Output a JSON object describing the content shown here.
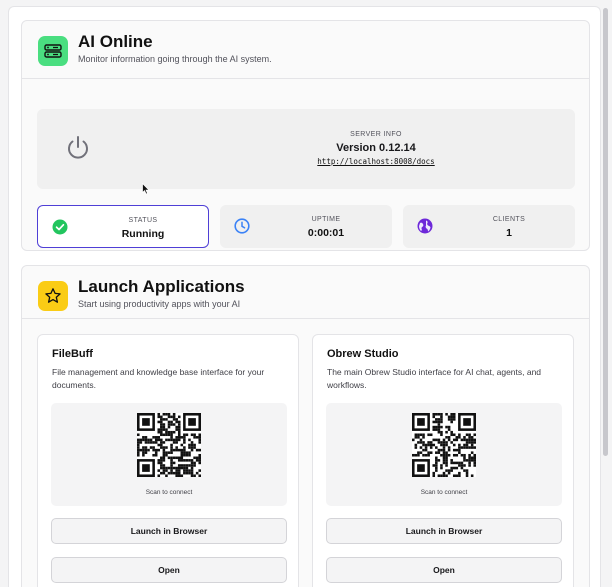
{
  "status_card": {
    "title": "AI Online",
    "subtitle": "Monitor information going through the AI system.",
    "icon": "server-icon",
    "icon_bg": "#4ade80",
    "server": {
      "label": "SERVER INFO",
      "version": "Version 0.12.14",
      "url": "http://localhost:8008/docs",
      "icon": "power-icon"
    },
    "stats": [
      {
        "label": "STATUS",
        "value": "Running",
        "icon": "check-circle-icon",
        "color": "#22c55e"
      },
      {
        "label": "UPTIME",
        "value": "0:00:01",
        "icon": "clock-icon",
        "color": "#3b82f6"
      },
      {
        "label": "CLIENTS",
        "value": "1",
        "icon": "globe-icon",
        "color": "#6d28d9"
      }
    ]
  },
  "launch_card": {
    "title": "Launch Applications",
    "subtitle": "Start using productivity apps with your AI",
    "icon": "star-icon",
    "icon_bg": "#facc15",
    "apps": [
      {
        "name": "FileBuff",
        "description": "File management and knowledge base interface for your documents.",
        "qr_caption": "Scan to connect",
        "launch_label": "Launch in Browser",
        "open_label": "Open"
      },
      {
        "name": "Obrew Studio",
        "description": "The main Obrew Studio interface for AI chat, agents, and workflows.",
        "qr_caption": "Scan to connect",
        "launch_label": "Launch in Browser",
        "open_label": "Open"
      }
    ]
  },
  "colors": {
    "accent_border": "#4f3fd6"
  }
}
